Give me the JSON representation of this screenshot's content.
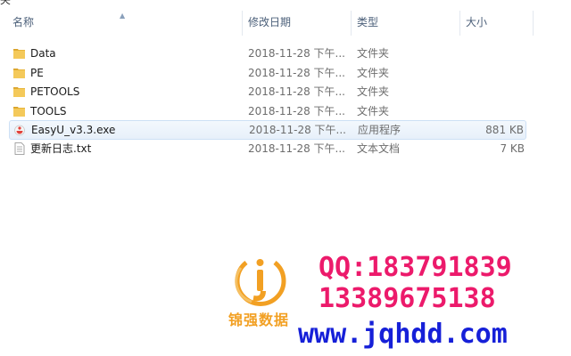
{
  "top_strip_text": "夹",
  "columns": {
    "name": "名称",
    "date": "修改日期",
    "type": "类型",
    "size": "大小"
  },
  "files": [
    {
      "name": "Data",
      "date": "2018-11-28 下午...",
      "type": "文件夹",
      "size": "",
      "icon": "folder-icon"
    },
    {
      "name": "PE",
      "date": "2018-11-28 下午...",
      "type": "文件夹",
      "size": "",
      "icon": "folder-icon"
    },
    {
      "name": "PETOOLS",
      "date": "2018-11-28 下午...",
      "type": "文件夹",
      "size": "",
      "icon": "folder-icon"
    },
    {
      "name": "TOOLS",
      "date": "2018-11-28 下午...",
      "type": "文件夹",
      "size": "",
      "icon": "folder-icon"
    },
    {
      "name": "EasyU_v3.3.exe",
      "date": "2018-11-28 下午...",
      "type": "应用程序",
      "size": "881 KB",
      "icon": "app-icon",
      "selected": true
    },
    {
      "name": "更新日志.txt",
      "date": "2018-11-28 下午...",
      "type": "文本文档",
      "size": "7 KB",
      "icon": "text-file-icon"
    }
  ],
  "watermark": {
    "logo_text": "锦强数据",
    "qq": "QQ:183791839",
    "phone": "13389675138",
    "url": "www.jqhdd.com",
    "colors": {
      "logo": "#f2a023",
      "contact": "#ec1a6b",
      "url": "#1620d8"
    }
  }
}
